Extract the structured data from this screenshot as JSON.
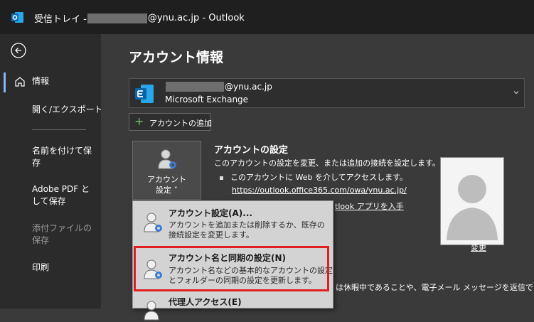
{
  "titlebar": {
    "app_name": "Outlook",
    "prefix": "受信トレイ - ",
    "email_suffix": "@ynu.ac.jp",
    "separator": " - "
  },
  "sidebar": {
    "items": [
      {
        "label": "情報"
      },
      {
        "label": "開く/エクスポート"
      },
      {
        "label": "名前を付けて保存"
      },
      {
        "label": "Adobe PDF として保存"
      },
      {
        "label": "添付ファイルの保存"
      },
      {
        "label": "印刷"
      }
    ]
  },
  "main": {
    "page_title": "アカウント情報",
    "account": {
      "email_suffix": "@ynu.ac.jp",
      "type": "Microsoft Exchange"
    },
    "add_account_label": "アカウントの追加",
    "settings_button": {
      "line1": "アカウント",
      "line2": "設定 ˅"
    },
    "settings_section": {
      "title": "アカウントの設定",
      "desc": "このアカウントの設定を変更、または追加の接続を設定します。",
      "bullet": "このアカウントに Web を介してアクセスします。",
      "link": "https://outlook.office365.com/owa/ynu.ac.jp/",
      "link2": "tlook アプリを入手"
    },
    "change_label": "変更",
    "behind_text": "は休暇中であることや、電子メール メッセージを返信でき"
  },
  "dropdown": {
    "items": [
      {
        "title": "アカウント設定(A)...",
        "desc1": "アカウントを追加または削除するか、既存の",
        "desc2": "接続設定を変更します。"
      },
      {
        "title": "アカウント名と同期の設定(N)",
        "desc1": "アカウント名などの基本的なアカウントの設定",
        "desc2": "とフォルダーの同期の設定を更新します。"
      },
      {
        "title": "代理人アクセス(E)",
        "desc1": "",
        "desc2": ""
      }
    ]
  },
  "colors": {
    "highlight": "#e02020",
    "titlebar_bg": "#1f1f1f",
    "sidebar_bg": "#2b2b2b",
    "main_bg": "#3a3a3a",
    "outlook_blue": "#0f6cbd"
  }
}
